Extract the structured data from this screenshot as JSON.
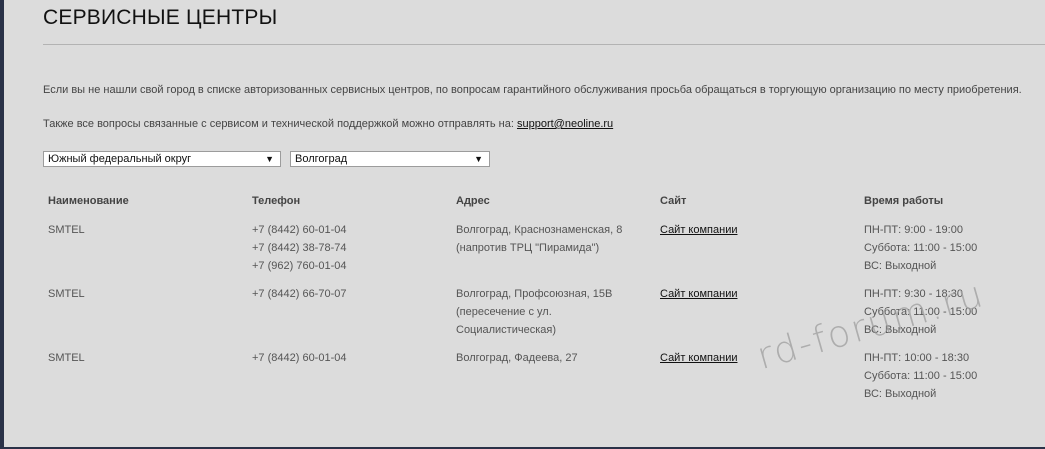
{
  "title": "СЕРВИСНЫЕ ЦЕНТРЫ",
  "info_text_1": "Если вы не нашли свой город в списке авторизованных сервисных центров, по вопросам гарантийного обслуживания просьба обращаться в торгующую организацию по месту приобретения.",
  "info_text_2": "Также все вопросы связанные с сервисом и технической поддержкой можно отправлять на:",
  "support_email": "support@neoline.ru",
  "filters": {
    "region": "Южный федеральный округ",
    "city": "Волгоград"
  },
  "table": {
    "headers": [
      "Наименование",
      "Телефон",
      "Адрес",
      "Сайт",
      "Время работы"
    ],
    "rows": [
      {
        "name": "SMTEL",
        "phones": [
          "+7 (8442) 60-01-04",
          "+7 (8442) 38-78-74",
          "+7 (962) 760-01-04"
        ],
        "address": [
          "Волгоград, Краснознаменская, 8",
          "(напротив ТРЦ \"Пирамида\")"
        ],
        "site": "Сайт компании",
        "hours": [
          "ПН-ПТ: 9:00 - 19:00",
          "Суббота: 11:00 - 15:00",
          "ВС: Выходной"
        ]
      },
      {
        "name": "SMTEL",
        "phones": [
          "+7 (8442) 66-70-07"
        ],
        "address": [
          "Волгоград, Профсоюзная, 15В",
          "(пересечение с ул.",
          "Социалистическая)"
        ],
        "site": "Сайт компании",
        "hours": [
          "ПН-ПТ: 9:30 - 18:30",
          "Суббота: 11:00 - 15:00",
          "ВС: Выходной"
        ]
      },
      {
        "name": "SMTEL",
        "phones": [
          "+7 (8442) 60-01-04"
        ],
        "address": [
          "Волгоград, Фадеева, 27"
        ],
        "site": "Сайт компании",
        "hours": [
          "ПН-ПТ: 10:00 - 18:30",
          "Суббота: 11:00 - 15:00",
          "ВС: Выходной"
        ]
      }
    ]
  },
  "watermark": "rd-forum.ru",
  "colors": {
    "background": "#dcdcdc",
    "sidebar": "#2a3248"
  }
}
